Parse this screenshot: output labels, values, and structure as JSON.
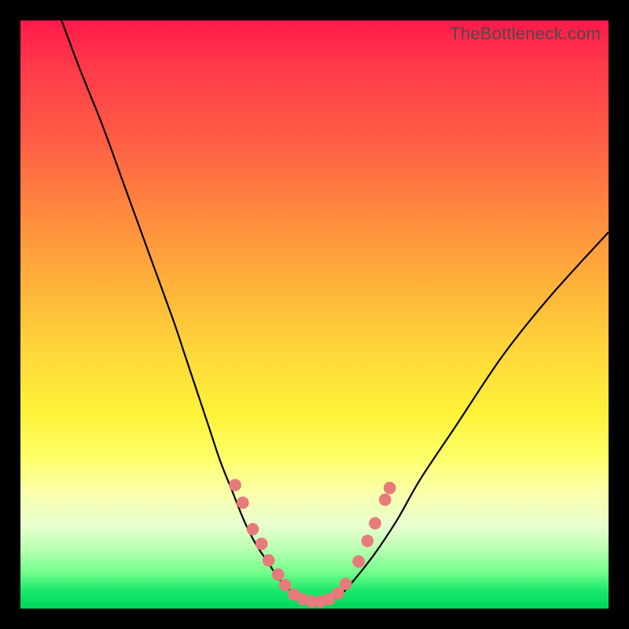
{
  "watermark": "TheBottleneck.com",
  "chart_data": {
    "type": "line",
    "title": "",
    "xlabel": "",
    "ylabel": "",
    "xlim": [
      0,
      100
    ],
    "ylim": [
      0,
      100
    ],
    "legend": false,
    "grid": false,
    "background": "rainbow-gradient-red-to-green",
    "series": [
      {
        "name": "bottleneck-curve",
        "color": "#000000",
        "x": [
          7,
          10,
          14,
          18,
          22,
          26,
          28,
          30,
          32,
          34,
          36,
          38,
          40,
          42,
          44,
          46,
          48,
          50,
          52,
          54,
          56,
          60,
          64,
          68,
          74,
          82,
          90,
          100
        ],
        "values": [
          100,
          92,
          82,
          71,
          60,
          49,
          43,
          37,
          31,
          25,
          20,
          15,
          11,
          8,
          5,
          3,
          2,
          1,
          1,
          2,
          4,
          9,
          15,
          22,
          31,
          43,
          53,
          64
        ]
      }
    ],
    "markers": [
      {
        "name": "point",
        "x": 36.5,
        "y": 21
      },
      {
        "name": "point",
        "x": 37.8,
        "y": 18
      },
      {
        "name": "point",
        "x": 39.5,
        "y": 13.5
      },
      {
        "name": "point",
        "x": 41.0,
        "y": 11
      },
      {
        "name": "point",
        "x": 42.2,
        "y": 8.2
      },
      {
        "name": "point",
        "x": 43.8,
        "y": 5.8
      },
      {
        "name": "point",
        "x": 45.0,
        "y": 4.0
      },
      {
        "name": "point",
        "x": 46.5,
        "y": 2.4
      },
      {
        "name": "point",
        "x": 48.0,
        "y": 1.6
      },
      {
        "name": "point",
        "x": 49.5,
        "y": 1.2
      },
      {
        "name": "point",
        "x": 51.0,
        "y": 1.2
      },
      {
        "name": "point",
        "x": 52.5,
        "y": 1.6
      },
      {
        "name": "point",
        "x": 54.0,
        "y": 2.6
      },
      {
        "name": "point",
        "x": 55.3,
        "y": 4.2
      },
      {
        "name": "point",
        "x": 57.5,
        "y": 8.0
      },
      {
        "name": "point",
        "x": 59.0,
        "y": 11.5
      },
      {
        "name": "point",
        "x": 60.3,
        "y": 14.5
      },
      {
        "name": "point",
        "x": 62.0,
        "y": 18.5
      },
      {
        "name": "point",
        "x": 62.8,
        "y": 20.5
      }
    ],
    "marker_style": {
      "color": "#e77b7b",
      "radius_pct": 1.05
    }
  }
}
